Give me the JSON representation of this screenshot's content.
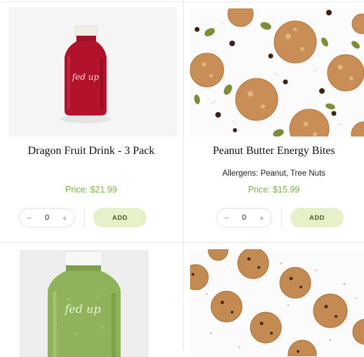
{
  "products": [
    {
      "title": "Dragon Fruit Drink - 3 Pack",
      "allergens": "",
      "price": "Price: $21.99",
      "quantity": "0",
      "add_label": "ADD",
      "image_icon": "red-juice-bottle",
      "brand_text": "fed up"
    },
    {
      "title": "Peanut Butter Energy Bites",
      "allergens": "Allergens: Peanut, Tree Nuts",
      "price": "Price: $15.99",
      "quantity": "0",
      "add_label": "ADD",
      "image_icon": "energy-bites-photo"
    },
    {
      "image_icon": "green-juice-bottle",
      "brand_text": "fed up"
    },
    {
      "image_icon": "energy-bites-photo"
    }
  ],
  "stepper": {
    "minus": "−",
    "plus": "+"
  },
  "colors": {
    "price": "#7cb342",
    "add_bg": "#e6f0c9",
    "red_juice": "#b3122c",
    "green_juice": "#8fb35a"
  }
}
